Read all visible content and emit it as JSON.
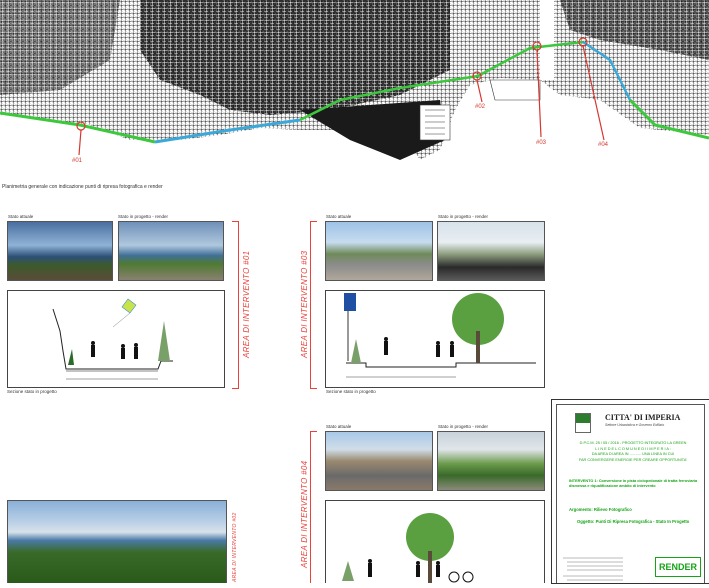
{
  "map": {
    "caption": "Planimetria generale con indicazione punti di ripresa fotografica e render",
    "markers": [
      "#01",
      "#02",
      "#03",
      "#04"
    ]
  },
  "panel1": {
    "photo_current_label": "Stato attuale",
    "photo_project_label": "Stato in progetto - render",
    "section_caption": "Sezione stato in progetto",
    "area_title": "AREA DI INTERVENTO #01"
  },
  "panel3": {
    "photo_current_label": "Stato attuale",
    "photo_project_label": "Stato in progetto - render",
    "section_caption": "Sezione stato in progetto",
    "area_title": "AREA DI INTERVENTO #03"
  },
  "panel4": {
    "photo_current_label": "Stato attuale",
    "photo_project_label": "Stato in progetto - render",
    "area_title": "AREA DI INTERVENTO #04"
  },
  "panel2": {
    "area_title": "AREA DI INTERVENTO #02"
  },
  "title_block": {
    "city": "CITTA' DI IMPERIA",
    "dept": "Settore Urbanistica e Governo Edilizio",
    "project_line1": "D.P.C.M. 25 / 05 / 2016 - PROGETTO INTEGRATO LA GREEN",
    "project_line2": "L I N E   D E L   C O M U N E   D I   I M P E R I A :",
    "project_line3": "DA AREA DI AREA IN ........... UNA LINEA IN CUI",
    "project_line4": "FAR CONVERGERE ENERGIE PER CREARE OPPORTUNITA'",
    "intervento": "INTERVENTO 1: Conversione in pista ciclopedonale di tratta ferroviaria dismessa e riqualificazione ambito di intervento",
    "argomento": "Argomento: Rilievo Fotografico",
    "oggetto": "Oggetto: Punti Di Ripresa Fotografica - Stato In Progetto",
    "render_label": "RENDER"
  },
  "colors": {
    "accent_red": "#e8423a",
    "green_route": "#3cc83c",
    "blue_route": "#3aa8d8",
    "title_green": "#16a316"
  }
}
